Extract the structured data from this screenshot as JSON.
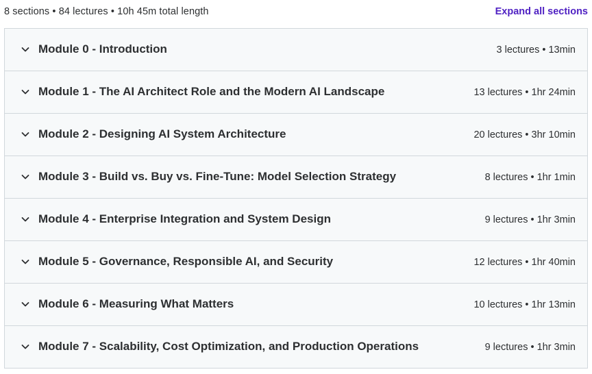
{
  "header": {
    "summary": "8 sections • 84 lectures • 10h 45m total length",
    "expand_label": "Expand all sections"
  },
  "icons": {
    "chevron": "chevron-down-icon"
  },
  "colors": {
    "accent": "#5022c3",
    "row_background": "#f7f9fa",
    "border": "#d1d7dc",
    "text": "#2d2f31"
  },
  "sections": [
    {
      "title": "Module 0 - Introduction",
      "meta": "3 lectures • 13min"
    },
    {
      "title": "Module 1 - The AI Architect Role and the Modern AI Landscape",
      "meta": "13 lectures • 1hr 24min"
    },
    {
      "title": "Module 2 - Designing AI System Architecture",
      "meta": "20 lectures • 3hr 10min"
    },
    {
      "title": "Module 3 - Build vs. Buy vs. Fine-Tune: Model Selection Strategy",
      "meta": "8 lectures • 1hr 1min"
    },
    {
      "title": "Module 4 - Enterprise Integration and System Design",
      "meta": "9 lectures • 1hr 3min"
    },
    {
      "title": "Module 5 - Governance, Responsible AI, and Security",
      "meta": "12 lectures • 1hr 40min"
    },
    {
      "title": "Module 6 - Measuring What Matters",
      "meta": "10 lectures • 1hr 13min"
    },
    {
      "title": "Module 7 - Scalability, Cost Optimization, and Production Operations",
      "meta": "9 lectures • 1hr 3min"
    }
  ]
}
